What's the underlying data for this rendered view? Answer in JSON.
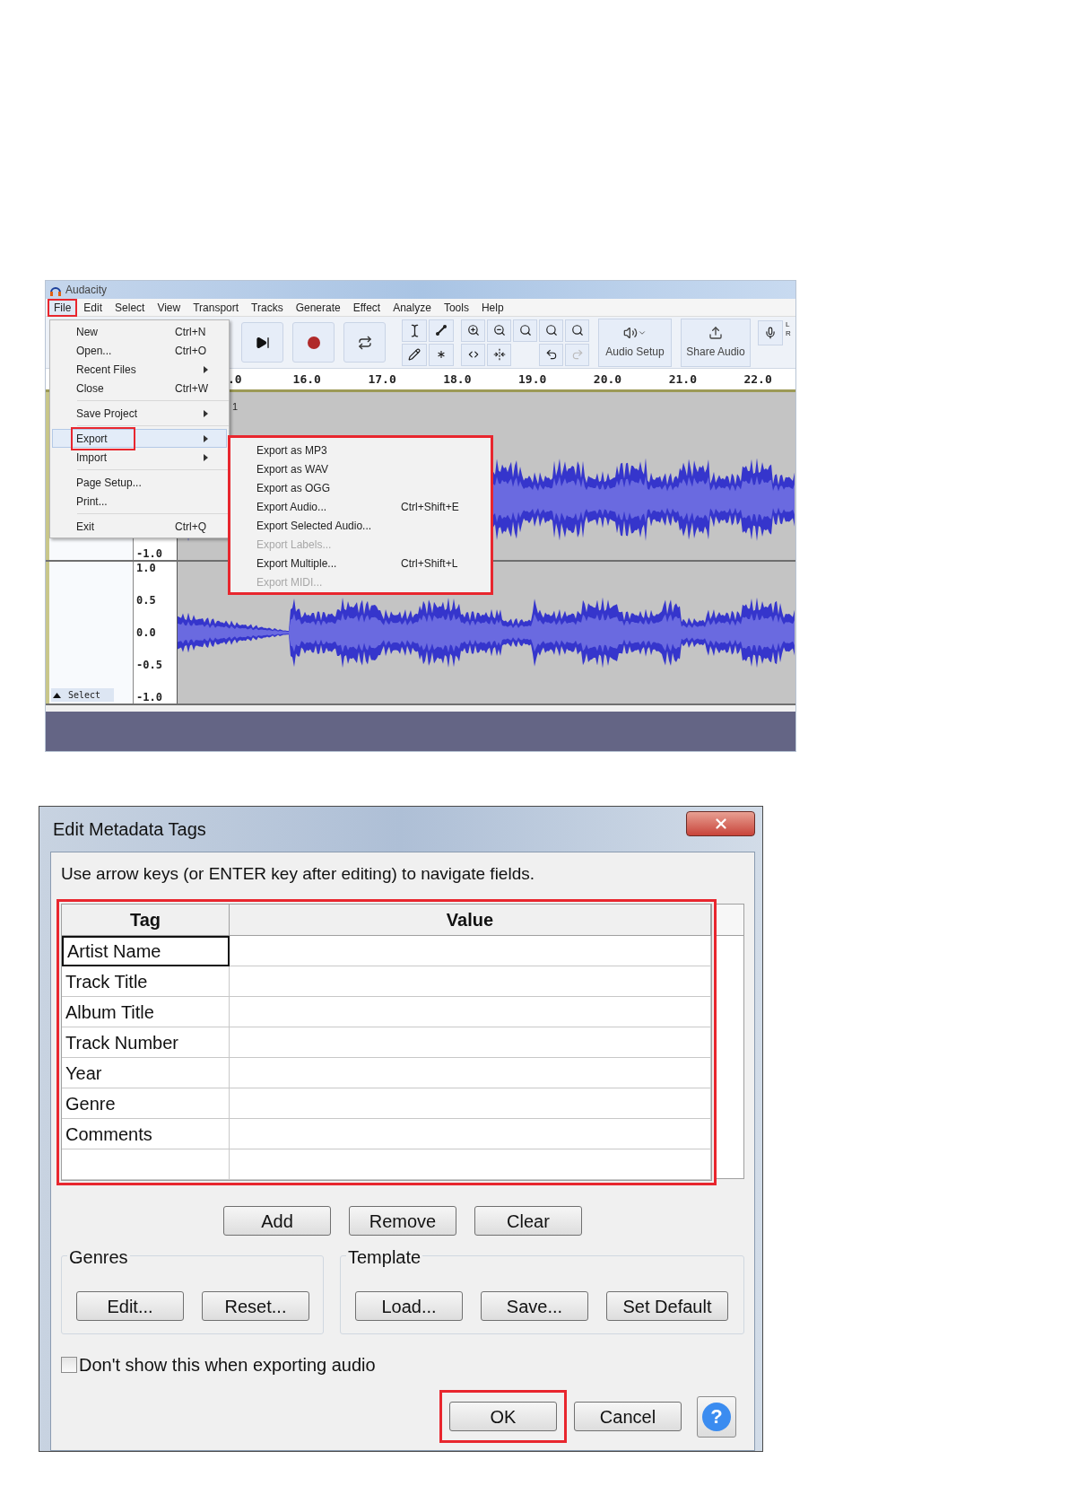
{
  "audacity_window": {
    "title": "Audacity",
    "menu_bar": [
      {
        "label": "File",
        "selected": true,
        "highlighted": true
      },
      {
        "label": "Edit",
        "selected": false,
        "highlighted": false
      },
      {
        "label": "Select",
        "selected": false,
        "highlighted": false
      },
      {
        "label": "View",
        "selected": false,
        "highlighted": false
      },
      {
        "label": "Transport",
        "selected": false,
        "highlighted": false
      },
      {
        "label": "Tracks",
        "selected": false,
        "highlighted": false
      },
      {
        "label": "Generate",
        "selected": false,
        "highlighted": false
      },
      {
        "label": "Effect",
        "selected": false,
        "highlighted": false
      },
      {
        "label": "Analyze",
        "selected": false,
        "highlighted": false
      },
      {
        "label": "Tools",
        "selected": false,
        "highlighted": false
      },
      {
        "label": "Help",
        "selected": false,
        "highlighted": false
      }
    ],
    "file_menu": [
      {
        "kind": "item",
        "label": "New",
        "shortcut": "Ctrl+N",
        "submenu": false,
        "selected": false,
        "highlighted": false
      },
      {
        "kind": "item",
        "label": "Open...",
        "shortcut": "Ctrl+O",
        "submenu": false,
        "selected": false,
        "highlighted": false
      },
      {
        "kind": "item",
        "label": "Recent Files",
        "submenu": true,
        "selected": false,
        "highlighted": false
      },
      {
        "kind": "item",
        "label": "Close",
        "shortcut": "Ctrl+W",
        "submenu": false,
        "selected": false,
        "highlighted": false
      },
      {
        "kind": "separator"
      },
      {
        "kind": "item",
        "label": "Save Project",
        "submenu": true,
        "selected": false,
        "highlighted": false
      },
      {
        "kind": "separator"
      },
      {
        "kind": "item",
        "label": "Export",
        "submenu": true,
        "selected": true,
        "highlighted": true
      },
      {
        "kind": "item",
        "label": "Import",
        "submenu": true,
        "selected": false,
        "highlighted": false
      },
      {
        "kind": "separator"
      },
      {
        "kind": "item",
        "label": "Page Setup...",
        "submenu": false,
        "selected": false,
        "highlighted": false
      },
      {
        "kind": "item",
        "label": "Print...",
        "submenu": false,
        "selected": false,
        "highlighted": false
      },
      {
        "kind": "separator"
      },
      {
        "kind": "item",
        "label": "Exit",
        "shortcut": "Ctrl+Q",
        "submenu": false,
        "selected": false,
        "highlighted": false
      }
    ],
    "export_submenu": {
      "highlighted": true,
      "items": [
        {
          "label": "Export as MP3",
          "disabled": false
        },
        {
          "label": "Export as WAV",
          "disabled": false
        },
        {
          "label": "Export as OGG",
          "disabled": false
        },
        {
          "label": "Export Audio...",
          "shortcut": "Ctrl+Shift+E",
          "disabled": false
        },
        {
          "label": "Export Selected Audio...",
          "disabled": false
        },
        {
          "label": "Export Labels...",
          "disabled": true
        },
        {
          "label": "Export Multiple...",
          "shortcut": "Ctrl+Shift+L",
          "disabled": false
        },
        {
          "label": "Export MIDI...",
          "disabled": true
        }
      ]
    },
    "toolbar": {
      "audio_setup": "Audio Setup",
      "share_audio": "Share Audio",
      "meter_labels": [
        "L",
        "R"
      ]
    },
    "ruler": [
      ".0",
      "16.0",
      "17.0",
      "18.0",
      "19.0",
      "20.0",
      "21.0",
      "22.0"
    ],
    "tracks": [
      {
        "name_fragment": "1",
        "scale": [
          "-1.0"
        ]
      },
      {
        "scale": [
          "1.0",
          "0.5",
          "0.0",
          "-0.5",
          "-1.0"
        ],
        "select_button": "Select"
      }
    ]
  },
  "metadata_dialog": {
    "title": "Edit Metadata Tags",
    "instruction": "Use arrow keys (or ENTER key after editing) to navigate fields.",
    "table": {
      "highlighted": true,
      "columns": [
        "Tag",
        "Value"
      ],
      "rows": [
        {
          "tag": "Artist Name",
          "selected": true
        },
        {
          "tag": "Track Title",
          "selected": false
        },
        {
          "tag": "Album Title",
          "selected": false
        },
        {
          "tag": "Track Number",
          "selected": false
        },
        {
          "tag": "Year",
          "selected": false
        },
        {
          "tag": "Genre",
          "selected": false
        },
        {
          "tag": "Comments",
          "selected": false
        },
        {
          "selected": false
        }
      ]
    },
    "table_buttons": [
      "Add",
      "Remove",
      "Clear"
    ],
    "groups": [
      {
        "title": "Genres",
        "buttons": [
          "Edit...",
          "Reset..."
        ]
      },
      {
        "title": "Template",
        "buttons": [
          "Load...",
          "Save...",
          "Set Default"
        ]
      }
    ],
    "checkbox": {
      "label": "Don't show this when exporting audio",
      "checked": false
    },
    "footer_buttons": [
      {
        "label": "OK",
        "highlighted": true
      },
      {
        "label": "Cancel",
        "highlighted": false
      }
    ],
    "help_button": "?"
  }
}
